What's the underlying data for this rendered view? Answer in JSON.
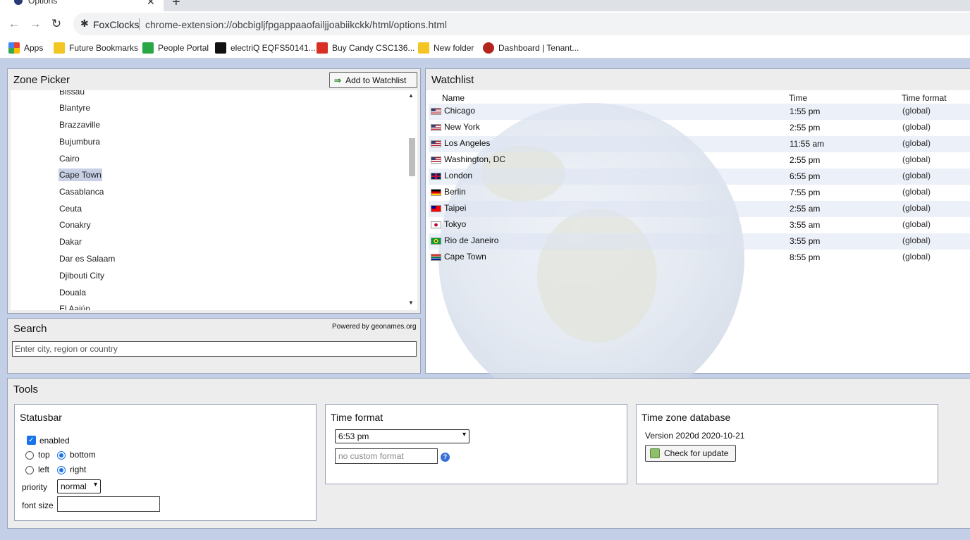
{
  "browser": {
    "tab_title": "Options",
    "tab_close": "✕",
    "new_tab": "+",
    "extension_name": "FoxClocks",
    "url": "chrome-extension://obcbigljfpgappaaofailjjoabiikckk/html/options.html",
    "bookmarks": [
      {
        "label": "Apps",
        "color": "#e94235"
      },
      {
        "label": "Future Bookmarks",
        "color": "#f3c623"
      },
      {
        "label": "People Portal",
        "color": "#2aa745"
      },
      {
        "label": "electriQ EQFS50141...",
        "color": "#111111"
      },
      {
        "label": "Buy Candy CSC136...",
        "color": "#d93025"
      },
      {
        "label": "New folder",
        "color": "#f3c623"
      },
      {
        "label": "Dashboard | Tenant...",
        "color": "#b3261e"
      }
    ]
  },
  "zone_picker": {
    "title": "Zone Picker",
    "add_button": "Add to Watchlist",
    "items": [
      "Bissau",
      "Blantyre",
      "Brazzaville",
      "Bujumbura",
      "Cairo",
      "Cape Town",
      "Casablanca",
      "Ceuta",
      "Conakry",
      "Dakar",
      "Dar es Salaam",
      "Djibouti City",
      "Douala",
      "El Aaiún"
    ],
    "selected": "Cape Town"
  },
  "search": {
    "title": "Search",
    "powered_by": "Powered by geonames.org",
    "placeholder": "Enter city, region or country"
  },
  "watchlist": {
    "title": "Watchlist",
    "columns": {
      "name": "Name",
      "time": "Time",
      "format": "Time format"
    },
    "rows": [
      {
        "name": "Chicago",
        "time": "1:55 pm",
        "format": "(global)",
        "flag": "us"
      },
      {
        "name": "New York",
        "time": "2:55 pm",
        "format": "(global)",
        "flag": "us"
      },
      {
        "name": "Los Angeles",
        "time": "11:55 am",
        "format": "(global)",
        "flag": "us"
      },
      {
        "name": "Washington, DC",
        "time": "2:55 pm",
        "format": "(global)",
        "flag": "us"
      },
      {
        "name": "London",
        "time": "6:55 pm",
        "format": "(global)",
        "flag": "gb"
      },
      {
        "name": "Berlin",
        "time": "7:55 pm",
        "format": "(global)",
        "flag": "de"
      },
      {
        "name": "Taipei",
        "time": "2:55 am",
        "format": "(global)",
        "flag": "tw"
      },
      {
        "name": "Tokyo",
        "time": "3:55 am",
        "format": "(global)",
        "flag": "jp"
      },
      {
        "name": "Rio de Janeiro",
        "time": "3:55 pm",
        "format": "(global)",
        "flag": "br"
      },
      {
        "name": "Cape Town",
        "time": "8:55 pm",
        "format": "(global)",
        "flag": "za"
      }
    ]
  },
  "tools": {
    "title": "Tools",
    "statusbar": {
      "title": "Statusbar",
      "enabled_label": "enabled",
      "enabled": true,
      "top_label": "top",
      "bottom_label": "bottom",
      "left_label": "left",
      "right_label": "right",
      "vertical": "bottom",
      "horizontal": "right",
      "priority_label": "priority",
      "priority_value": "normal",
      "font_size_label": "font size",
      "font_size_value": ""
    },
    "time_format": {
      "title": "Time format",
      "selected": "6:53 pm",
      "custom_placeholder": "no custom format",
      "help": "?"
    },
    "tz_database": {
      "title": "Time zone database",
      "version": "Version 2020d  2020-10-21",
      "update_button": "Check for update"
    }
  }
}
